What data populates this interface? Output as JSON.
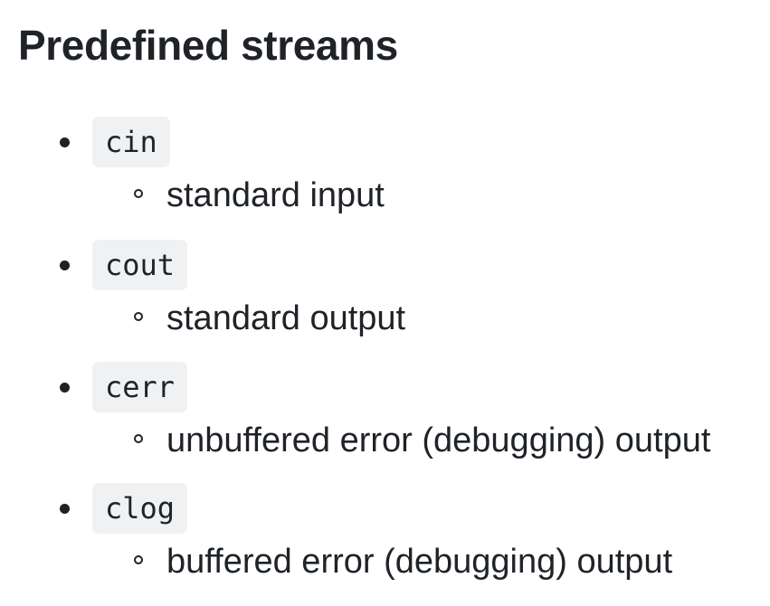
{
  "heading": "Predefined streams",
  "streams": [
    {
      "name": "cin",
      "description": "standard input"
    },
    {
      "name": "cout",
      "description": "standard output"
    },
    {
      "name": "cerr",
      "description": "unbuffered error (debugging) output"
    },
    {
      "name": "clog",
      "description": "buffered error (debugging) output"
    }
  ]
}
